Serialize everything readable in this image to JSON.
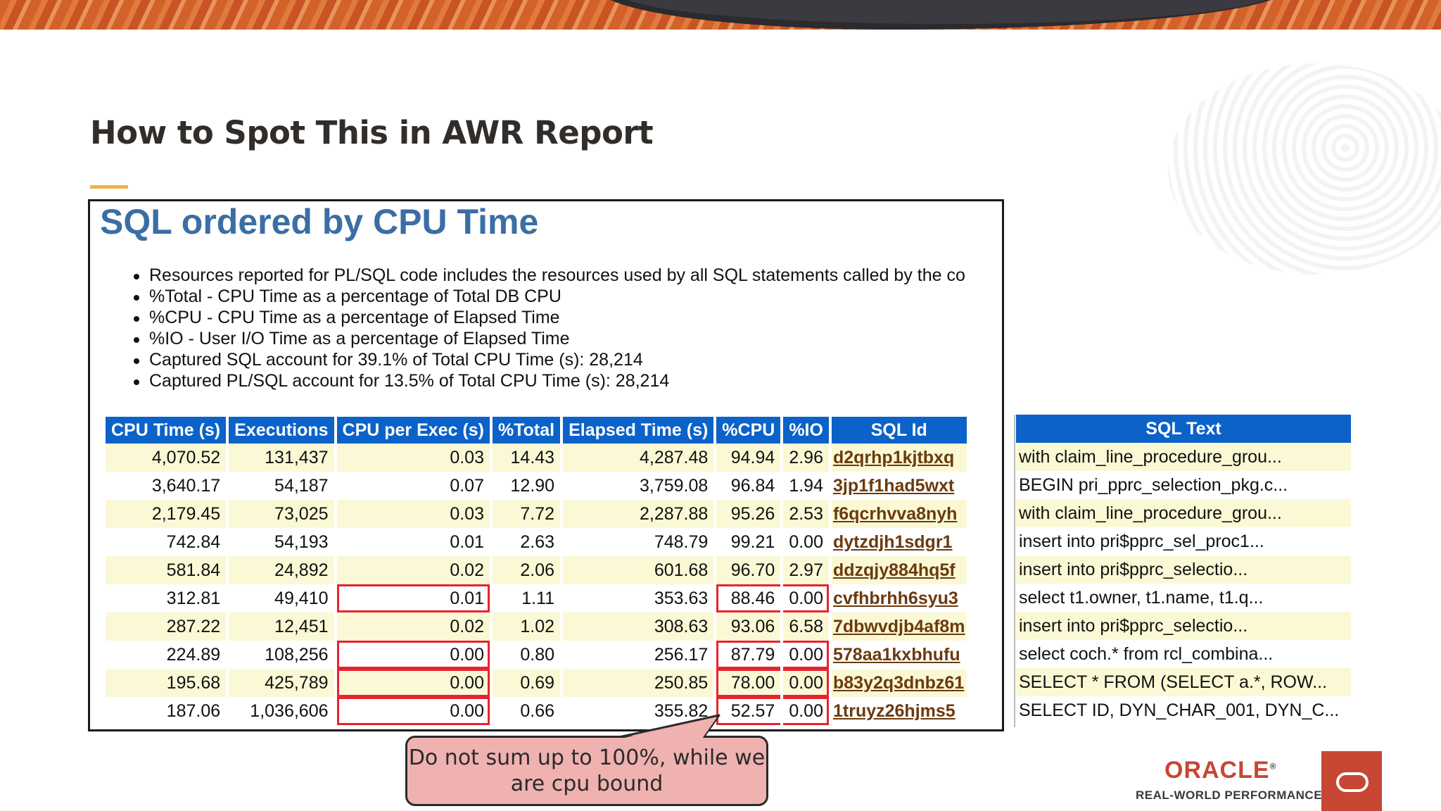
{
  "slide": {
    "title": "How to Spot This in AWR Report"
  },
  "report": {
    "heading": "SQL ordered by CPU Time",
    "notes": [
      "Resources reported for PL/SQL code includes the resources used by all SQL statements called by the co",
      "%Total - CPU Time as a percentage of Total DB CPU",
      "%CPU - CPU Time as a percentage of Elapsed Time",
      "%IO - User I/O Time as a percentage of Elapsed Time",
      "Captured SQL account for 39.1% of Total CPU Time (s): 28,214",
      "Captured PL/SQL account for 13.5% of Total CPU Time (s): 28,214"
    ],
    "columns": [
      "CPU Time (s)",
      "Executions",
      "CPU per Exec (s)",
      "%Total",
      "Elapsed Time (s)",
      "%CPU",
      "%IO",
      "SQL Id",
      "SQL Text"
    ],
    "rows": [
      [
        "4,070.52",
        "131,437",
        "0.03",
        "14.43",
        "4,287.48",
        "94.94",
        "2.96",
        "d2qrhp1kjtbxq",
        "with claim_line_procedure_grou..."
      ],
      [
        "3,640.17",
        "54,187",
        "0.07",
        "12.90",
        "3,759.08",
        "96.84",
        "1.94",
        "3jp1f1had5wxt",
        "BEGIN pri_pprc_selection_pkg.c..."
      ],
      [
        "2,179.45",
        "73,025",
        "0.03",
        "7.72",
        "2,287.88",
        "95.26",
        "2.53",
        "f6qcrhvva8nyh",
        "with claim_line_procedure_grou..."
      ],
      [
        "742.84",
        "54,193",
        "0.01",
        "2.63",
        "748.79",
        "99.21",
        "0.00",
        "dytzdjh1sdgr1",
        "insert into pri$pprc_sel_proc1..."
      ],
      [
        "581.84",
        "24,892",
        "0.02",
        "2.06",
        "601.68",
        "96.70",
        "2.97",
        "ddzqjy884hq5f",
        "insert into pri$pprc_selectio..."
      ],
      [
        "312.81",
        "49,410",
        "0.01",
        "1.11",
        "353.63",
        "88.46",
        "0.00",
        "cvfhbrhh6syu3",
        "select t1.owner, t1.name, t1.q..."
      ],
      [
        "287.22",
        "12,451",
        "0.02",
        "1.02",
        "308.63",
        "93.06",
        "6.58",
        "7dbwvdjb4af8m",
        "insert into pri$pprc_selectio..."
      ],
      [
        "224.89",
        "108,256",
        "0.00",
        "0.80",
        "256.17",
        "87.79",
        "0.00",
        "578aa1kxbhufu",
        "select coch.* from rcl_combina..."
      ],
      [
        "195.68",
        "425,789",
        "0.00",
        "0.69",
        "250.85",
        "78.00",
        "0.00",
        "b83y2q3dnbz61",
        "SELECT * FROM (SELECT a.*, ROW..."
      ],
      [
        "187.06",
        "1,036,606",
        "0.00",
        "0.66",
        "355.82",
        "52.57",
        "0.00",
        "1truyz26hjms5",
        "SELECT ID, DYN_CHAR_001, DYN_C..."
      ]
    ]
  },
  "callout": {
    "text": "Do not sum up to 100%, while we are cpu bound"
  },
  "branding": {
    "wordmark": "ORACLE",
    "registered": "®",
    "tagline": "REAL-WORLD PERFORMANCE",
    "color": "#c74634"
  },
  "colors": {
    "header_blue": "#0b62c9",
    "row_stripe": "#fbf9d5",
    "highlight_red": "#e8232f",
    "heading_blue": "#3a6ea5",
    "accent_yellow": "#f0b247"
  },
  "icons": {
    "badge": "oracle-logo-icon"
  }
}
